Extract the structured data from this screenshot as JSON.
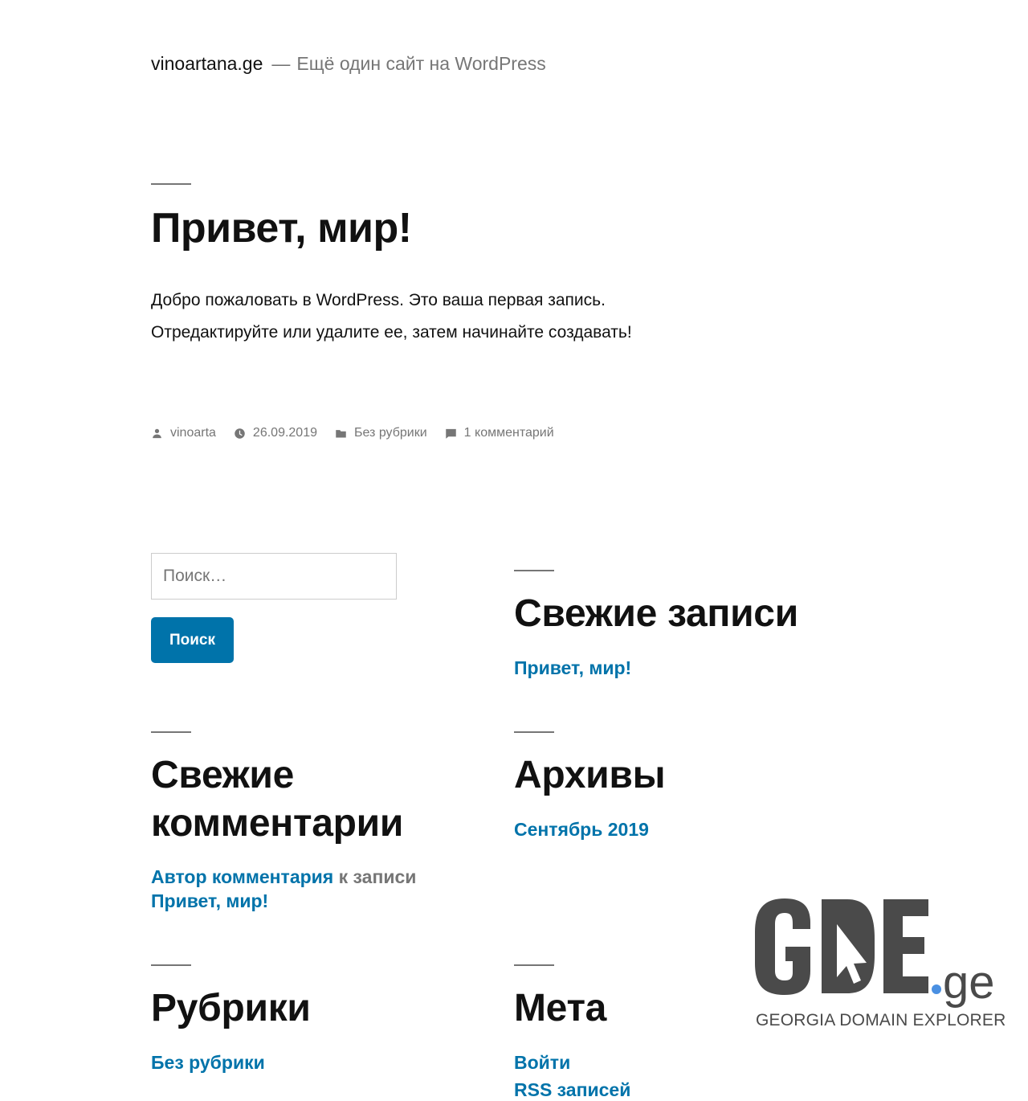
{
  "header": {
    "site_title": "vinoartana.ge",
    "separator": "—",
    "site_description": "Ещё один сайт на WordPress"
  },
  "post": {
    "title": "Привет, мир!",
    "body": "Добро пожаловать в WordPress. Это ваша первая запись. Отредактируйте или удалите ее, затем начинайте создавать!",
    "meta": {
      "author": "vinoarta",
      "date": "26.09.2019",
      "category": "Без рубрики",
      "comments": "1 комментарий"
    }
  },
  "search": {
    "placeholder": "Поиск…",
    "button_label": "Поиск"
  },
  "widgets": {
    "recent_posts": {
      "title": "Свежие записи",
      "items": [
        "Привет, мир!"
      ]
    },
    "recent_comments": {
      "title": "Свежие комментарии",
      "author": "Автор комментария",
      "connector": "к записи",
      "post": "Привет, мир!"
    },
    "archives": {
      "title": "Архивы",
      "items": [
        "Сентябрь 2019"
      ]
    },
    "categories": {
      "title": "Рубрики",
      "items": [
        "Без рубрики"
      ]
    },
    "meta": {
      "title": "Мета",
      "items": [
        "Войти",
        "RSS записей"
      ]
    }
  },
  "badge": {
    "tagline": "GEORGIA DOMAIN EXPLORER",
    "colors": {
      "text": "#4a4a4a",
      "dot": "#4a90e2"
    }
  },
  "colors": {
    "link": "#0073aa",
    "text": "#111111",
    "muted": "#767676",
    "button": "#0073aa"
  }
}
